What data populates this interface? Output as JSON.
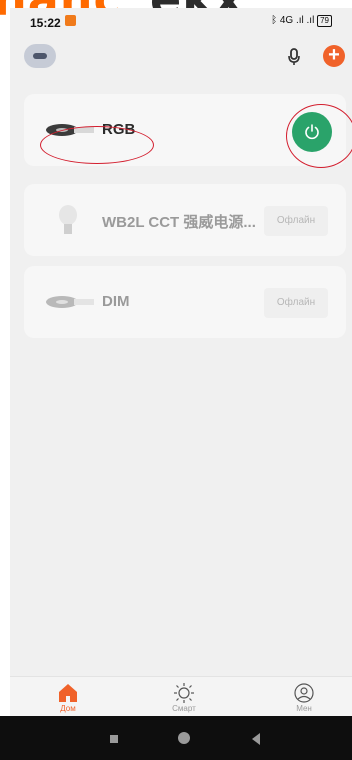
{
  "watermark": {
    "part1": "hanc",
    "part2": "ekx"
  },
  "status_bar": {
    "time": "15:22",
    "right_text": "ᛒ 4G .ıl .ıl",
    "battery": "79"
  },
  "devices": [
    {
      "name": "RGB",
      "state": "on"
    },
    {
      "name": "WB2L CCT 强威电源...",
      "status": "Офлайн"
    },
    {
      "name": "DIM",
      "status": "Офлайн"
    }
  ],
  "tabs": [
    {
      "label": "Дом",
      "active": true
    },
    {
      "label": "Смарт",
      "active": false
    },
    {
      "label": "Мен",
      "active": false
    }
  ],
  "colors": {
    "accent": "#f0622a",
    "power_on": "#2aa36a",
    "annotation": "#d31f2f"
  }
}
